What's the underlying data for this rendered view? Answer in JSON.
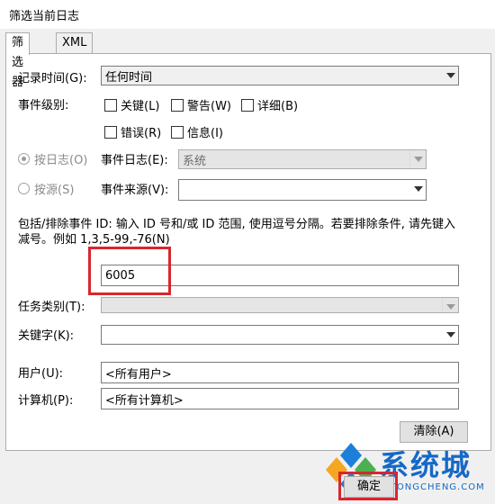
{
  "window": {
    "title": "筛选当前日志"
  },
  "tabs": [
    {
      "label": "筛选器"
    },
    {
      "label": "XML"
    }
  ],
  "form": {
    "logged_label": "记录时间(G):",
    "logged_value": "任何时间",
    "event_level_label": "事件级别:",
    "levels": [
      "关键(L)",
      "警告(W)",
      "详细(B)",
      "错误(R)",
      "信息(I)"
    ],
    "by_log_label": "按日志(O)",
    "by_source_label": "按源(S)",
    "event_logs_label": "事件日志(E):",
    "event_logs_value": "系统",
    "event_sources_label": "事件来源(V):",
    "event_sources_value": "",
    "event_id_desc": "包括/排除事件 ID: 输入 ID 号和/或 ID 范围, 使用逗号分隔。若要排除条件, 请先键入减号。例如 1,3,5-99,-76(N)",
    "event_id_value": "6005",
    "task_category_label": "任务类别(T):",
    "keywords_label": "关键字(K):",
    "user_label": "用户(U):",
    "user_value": "<所有用户>",
    "computer_label": "计算机(P):",
    "computer_value": "<所有计算机>"
  },
  "buttons": {
    "clear": "清除(A)",
    "ok": "确定"
  },
  "watermark": {
    "text": "系统城",
    "sub": "XITONGCHENG.COM"
  },
  "colors": {
    "highlight": "#d8262e",
    "watermark": "#1569c7"
  }
}
